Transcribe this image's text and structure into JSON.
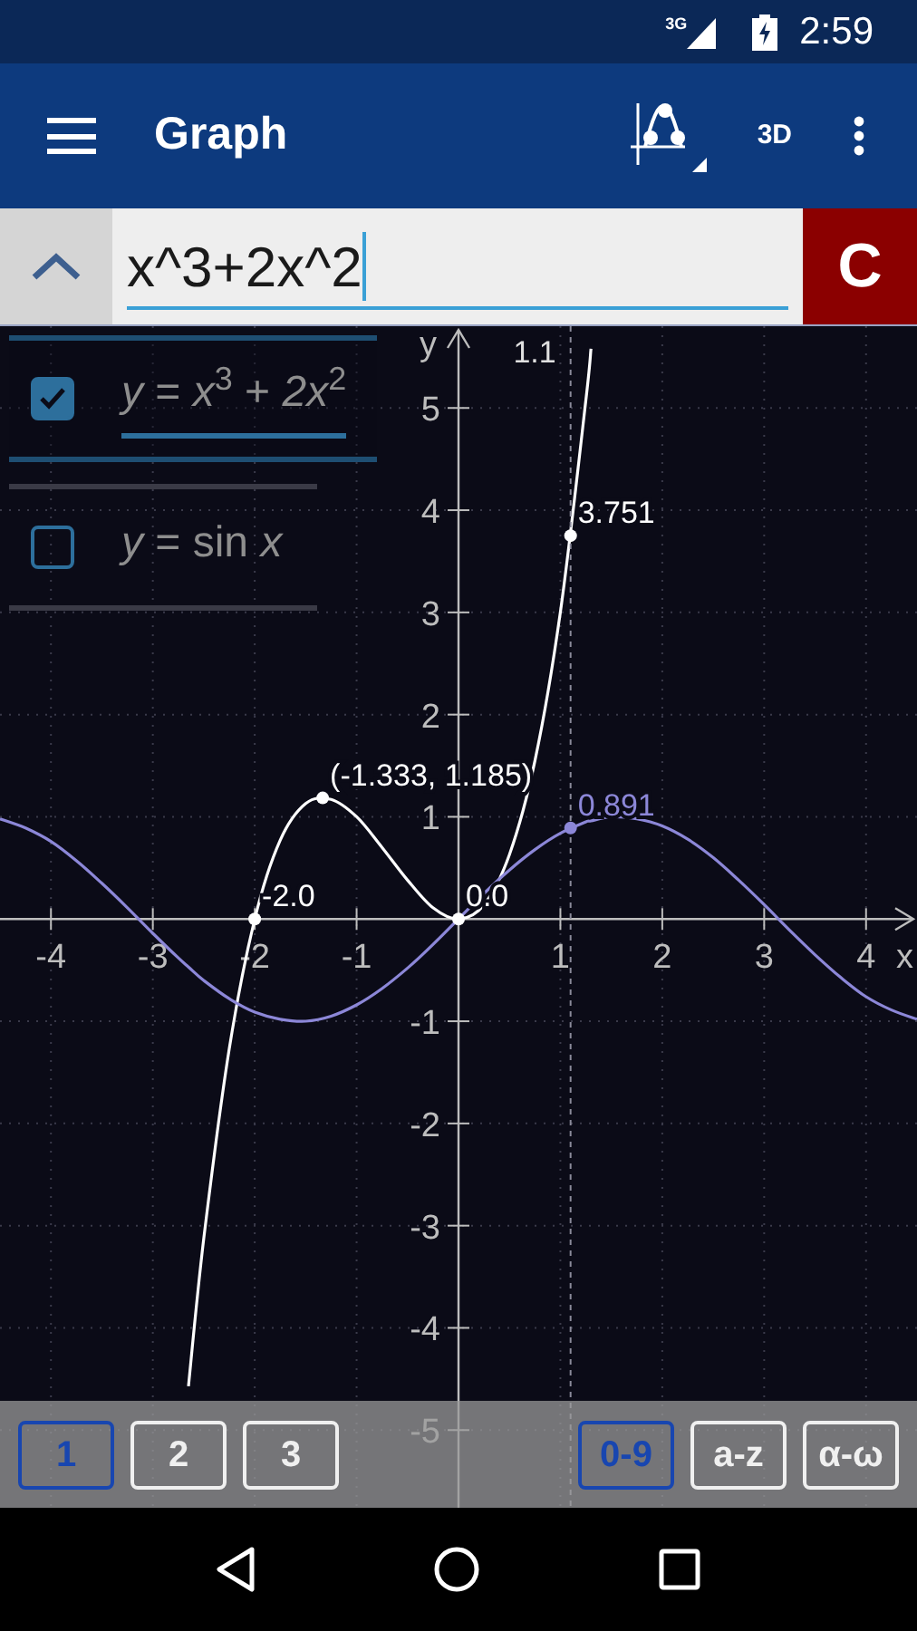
{
  "status_bar": {
    "network": "3G",
    "time": "2:59"
  },
  "app_bar": {
    "title": "Graph",
    "mode_button": "3D"
  },
  "input": {
    "value": "x^3+2x^2",
    "clear_button": "C"
  },
  "functions": [
    {
      "expression": "*y* = *x*$^{3}$ + *2x*$^{2}$",
      "checked": true,
      "selected": true
    },
    {
      "expression": "*y* = sin *x*",
      "checked": false,
      "selected": false
    }
  ],
  "graph": {
    "chart_data": {
      "type": "line",
      "xlabel": "x",
      "ylabel": "y",
      "xlim": [
        -4.5,
        4.5
      ],
      "ylim": [
        -5.76,
        5.8
      ],
      "grid": true,
      "xticks": [
        -4,
        -3,
        -2,
        -1,
        1,
        2,
        3,
        4
      ],
      "yticks": [
        -5,
        -4,
        -3,
        -2,
        -1,
        1,
        2,
        3,
        4,
        5
      ],
      "x": [
        -4.5,
        -4.25,
        -4,
        -3.75,
        -3.5,
        -3.25,
        -3,
        -2.75,
        -2.65,
        -2.5,
        -2.25,
        -2,
        -1.75,
        -1.5,
        -1.25,
        -1,
        -0.75,
        -0.5,
        -0.25,
        0,
        0.25,
        0.5,
        0.75,
        1,
        1.25,
        1.3,
        1.5,
        1.75,
        2,
        2.25,
        2.5,
        2.75,
        3,
        3.25,
        3.5,
        3.75,
        4,
        4.25,
        4.5
      ],
      "series": [
        {
          "color": "#ffffff",
          "values": [
            null,
            null,
            null,
            null,
            null,
            null,
            null,
            null,
            -4.57,
            -3.13,
            -1.27,
            0,
            0.77,
            1.13,
            1.17,
            1,
            0.7,
            0.38,
            0.11,
            0,
            0.14,
            0.63,
            1.55,
            3,
            5.08,
            5.58,
            null,
            null,
            null,
            null,
            null,
            null,
            null,
            null,
            null,
            null,
            null,
            null,
            null
          ]
        },
        {
          "color": "#8c87d8",
          "values": [
            0.98,
            0.89,
            0.76,
            0.57,
            0.35,
            0.11,
            -0.14,
            -0.38,
            -0.47,
            -0.6,
            -0.78,
            -0.91,
            -0.98,
            -1,
            -0.95,
            -0.84,
            -0.68,
            -0.48,
            -0.25,
            0,
            0.25,
            0.48,
            0.68,
            0.84,
            0.95,
            0.96,
            1,
            0.98,
            0.91,
            0.78,
            0.6,
            0.38,
            0.14,
            -0.11,
            -0.35,
            -0.57,
            -0.76,
            -0.89,
            -0.98
          ]
        }
      ],
      "ref_lines": [
        {
          "axis": "x",
          "value": 1.1,
          "label": "1.1"
        }
      ],
      "annotations": [
        {
          "x": -2,
          "y": 0,
          "text": "-2.0"
        },
        {
          "x": -1.333,
          "y": 1.185,
          "text": "(-1.333, 1.185)"
        },
        {
          "x": 0,
          "y": 0,
          "text": "0.0"
        },
        {
          "x": 1.1,
          "y": 3.751,
          "text": "3.751"
        },
        {
          "x": 1.1,
          "y": 0.891,
          "text": "0.891"
        }
      ]
    }
  },
  "keyboard_tabs": [
    {
      "label": "1",
      "selected": true
    },
    {
      "label": "2",
      "selected": false
    },
    {
      "label": "3",
      "selected": false
    }
  ],
  "keyboard_modes": [
    {
      "label": "0-9",
      "selected": true
    },
    {
      "label": "a-z",
      "selected": false
    },
    {
      "label": "α-ω",
      "selected": false
    }
  ]
}
